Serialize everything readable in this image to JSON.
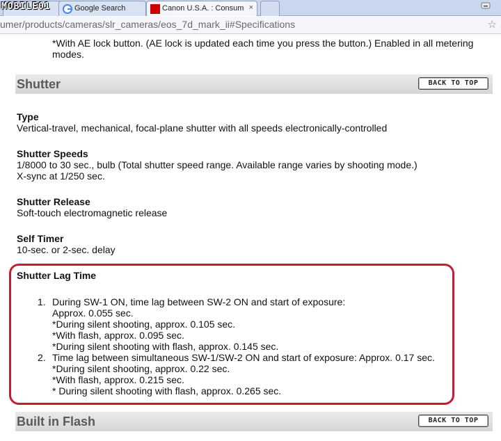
{
  "browser": {
    "logo_text": "MOBILE01",
    "tabs": [
      {
        "title": "",
        "icon": "mobile01-favicon"
      },
      {
        "title": "Google Search",
        "icon": "google-favicon"
      },
      {
        "title": "Canon U.S.A. : Consumer & Home Office",
        "icon": "canon-favicon",
        "active": true
      }
    ],
    "address": "umer/products/cameras/slr_cameras/eos_7d_mark_ii#Specifications"
  },
  "page": {
    "top_note": "*With AE lock button. (AE lock is updated each time you press the button.) Enabled in all metering modes.",
    "back_to_top": "BACK TO TOP",
    "shutter_section": {
      "title": "Shutter",
      "specs": [
        {
          "label": "Type",
          "lines": [
            "Vertical-travel, mechanical, focal-plane shutter with all speeds electronically-controlled"
          ]
        },
        {
          "label": "Shutter Speeds",
          "lines": [
            "1/8000 to 30 sec., bulb (Total shutter speed range. Available range varies by shooting mode.)",
            "X-sync at 1/250 sec."
          ]
        },
        {
          "label": "Shutter Release",
          "lines": [
            "Soft-touch electromagnetic release"
          ]
        },
        {
          "label": "Self Timer",
          "lines": [
            "10-sec. or 2-sec. delay"
          ]
        }
      ],
      "shutter_lag": {
        "label": "Shutter Lag Time",
        "items": [
          {
            "num": "1.",
            "lines": [
              "During SW-1 ON, time lag between SW-2 ON and start of exposure:",
              "Approx. 0.055 sec.",
              "*During silent shooting, approx. 0.105 sec.",
              "*With flash, approx. 0.095 sec.",
              "*During silent shooting with flash, approx. 0.145 sec."
            ]
          },
          {
            "num": "2.",
            "lines": [
              "Time lag between simultaneous SW-1/SW-2 ON and start of exposure: Approx. 0.17 sec.",
              "*During silent shooting, approx. 0.22 sec.",
              "*With flash, approx. 0.215 sec.",
              "* During silent shooting with flash, approx. 0.265 sec."
            ]
          }
        ]
      }
    },
    "flash_section": {
      "title": "Built in Flash"
    }
  },
  "colors": {
    "highlight_border": "#c41e32",
    "canon_red": "#cc0000",
    "section_text": "#5a5a5a"
  }
}
